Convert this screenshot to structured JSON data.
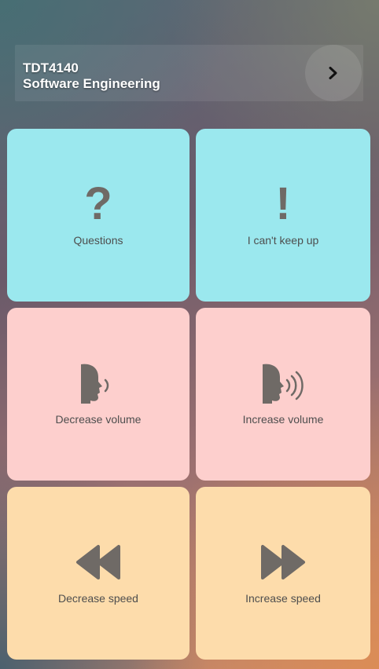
{
  "header": {
    "course_code": "TDT4140",
    "course_name": "Software Engineering",
    "next_icon": "chevron-right-icon"
  },
  "tiles": [
    {
      "label": "Questions",
      "icon": "question-mark-icon",
      "glyph": "?",
      "color": "#9be8ee"
    },
    {
      "label": "I can't keep up",
      "icon": "exclamation-mark-icon",
      "glyph": "!",
      "color": "#9be8ee"
    },
    {
      "label": "Decrease volume",
      "icon": "speaking-head-low-icon",
      "color": "#fdcfcd"
    },
    {
      "label": "Increase volume",
      "icon": "speaking-head-loud-icon",
      "color": "#fdcfcd"
    },
    {
      "label": "Decrease speed",
      "icon": "rewind-icon",
      "color": "#fddcab"
    },
    {
      "label": "Increase speed",
      "icon": "fast-forward-icon",
      "color": "#fddcab"
    }
  ]
}
